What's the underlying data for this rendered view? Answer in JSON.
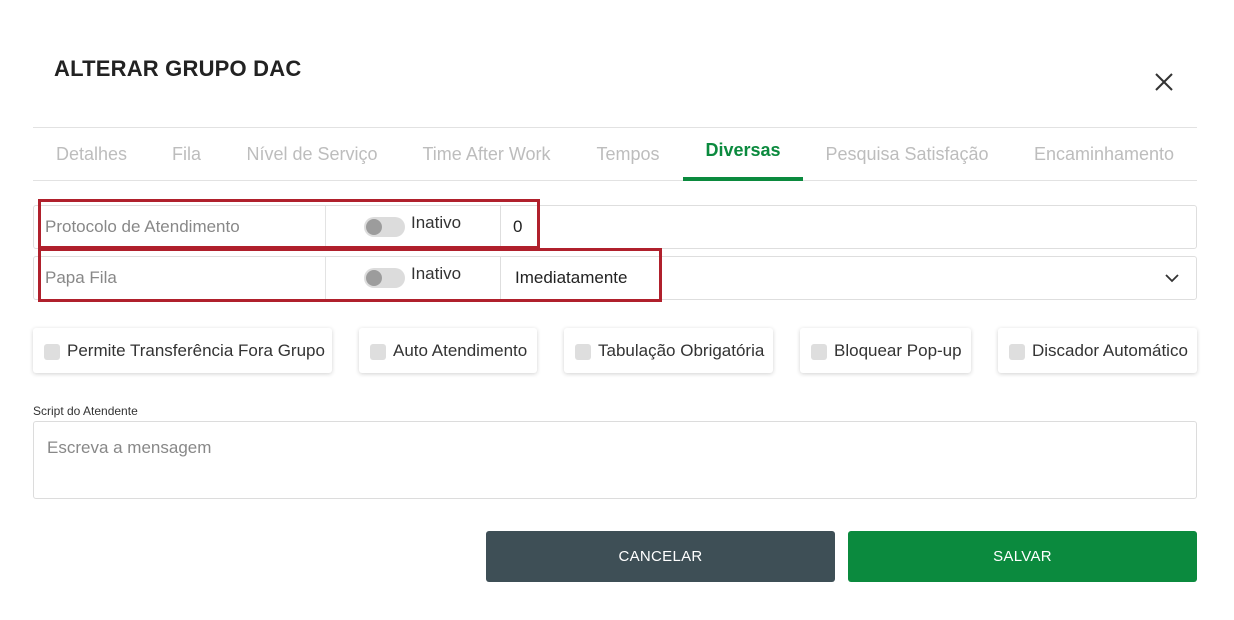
{
  "modal": {
    "title": "ALTERAR GRUPO DAC"
  },
  "tabs": [
    {
      "label": "Detalhes",
      "active": false
    },
    {
      "label": "Fila",
      "active": false
    },
    {
      "label": "Nível de Serviço",
      "active": false
    },
    {
      "label": "Time After Work",
      "active": false
    },
    {
      "label": "Tempos",
      "active": false
    },
    {
      "label": "Diversas",
      "active": true
    },
    {
      "label": "Pesquisa Satisfação",
      "active": false
    },
    {
      "label": "Encaminhamento",
      "active": false
    }
  ],
  "protocolo": {
    "label": "Protocolo de Atendimento",
    "toggle_label": "Inativo",
    "toggle_on": false,
    "value": "0"
  },
  "papa_fila": {
    "label": "Papa Fila",
    "toggle_label": "Inativo",
    "toggle_on": false,
    "selected": "Imediatamente",
    "icon": "chevron-down-icon"
  },
  "checkboxes": [
    {
      "label": "Permite Transferência Fora Grupo",
      "checked": false
    },
    {
      "label": "Auto Atendimento",
      "checked": false
    },
    {
      "label": "Tabulação Obrigatória",
      "checked": false
    },
    {
      "label": "Bloquear Pop-up",
      "checked": false
    },
    {
      "label": "Discador Automático",
      "checked": false
    }
  ],
  "script": {
    "label": "Script do Atendente",
    "placeholder": "Escreva a mensagem",
    "value": ""
  },
  "buttons": {
    "cancel": "CANCELAR",
    "save": "SALVAR"
  },
  "colors": {
    "accent": "#0b8a3e",
    "cancel_bg": "#3e4f56",
    "highlight": "#b0202c"
  }
}
